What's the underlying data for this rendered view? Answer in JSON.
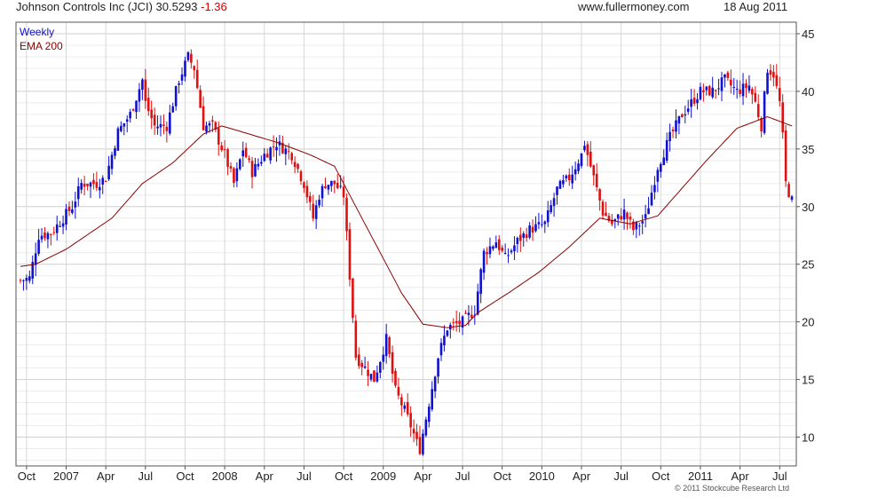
{
  "header": {
    "title": "Johnson Controls Inc (JCI) 30.5293",
    "change": "-1.36",
    "site": "www.fullermoney.com",
    "date": "18 Aug 2011"
  },
  "footer": {
    "copyright": "© 2011 Stockcube Research Ltd"
  },
  "colors": {
    "up": "#1010d0",
    "down": "#e01010",
    "ema": "#8b0000",
    "grid": "#d8d8d8"
  },
  "chart_data": {
    "type": "candlestick",
    "timeframe": "Weekly",
    "legend": [
      "Weekly",
      "EMA 200"
    ],
    "legend_position": "top-left",
    "ylim": [
      7.5,
      46
    ],
    "y_ticks": [
      10,
      15,
      20,
      25,
      30,
      35,
      40,
      45
    ],
    "x_ticks": [
      "Oct",
      "2007",
      "Apr",
      "Jul",
      "Oct",
      "2008",
      "Apr",
      "Jul",
      "Oct",
      "2009",
      "Apr",
      "Jul",
      "Oct",
      "2010",
      "Apr",
      "Jul",
      "Oct",
      "2011",
      "Apr",
      "Jul"
    ],
    "x_tick_weeks": [
      2,
      15,
      28,
      41,
      54,
      67,
      80,
      93,
      106,
      119,
      132,
      145,
      158,
      171,
      184,
      197,
      210,
      223,
      236,
      249
    ],
    "grid": true,
    "price_keypoints": [
      [
        0,
        23.6
      ],
      [
        3,
        23.8
      ],
      [
        6,
        27.5
      ],
      [
        10,
        27.7
      ],
      [
        14,
        29
      ],
      [
        17,
        30
      ],
      [
        20,
        32
      ],
      [
        25,
        32
      ],
      [
        28,
        32.5
      ],
      [
        32,
        36.5
      ],
      [
        36,
        38
      ],
      [
        40,
        41
      ],
      [
        41,
        39
      ],
      [
        44,
        37
      ],
      [
        48,
        37
      ],
      [
        52,
        41
      ],
      [
        55,
        43
      ],
      [
        57,
        42
      ],
      [
        60,
        37
      ],
      [
        63,
        37
      ],
      [
        67,
        34.5
      ],
      [
        70,
        32
      ],
      [
        73,
        35
      ],
      [
        76,
        33
      ],
      [
        80,
        34.5
      ],
      [
        84,
        35.5
      ],
      [
        89,
        34.5
      ],
      [
        93,
        32
      ],
      [
        96,
        29
      ],
      [
        98,
        31
      ],
      [
        100,
        32
      ],
      [
        103,
        32
      ],
      [
        106,
        31
      ],
      [
        108,
        24
      ],
      [
        110,
        17
      ],
      [
        113,
        16
      ],
      [
        116,
        15
      ],
      [
        120,
        18.5
      ],
      [
        123,
        14
      ],
      [
        126,
        12.3
      ],
      [
        128,
        11
      ],
      [
        130,
        9.5
      ],
      [
        131,
        9
      ],
      [
        134,
        13
      ],
      [
        137,
        17
      ],
      [
        140,
        19.5
      ],
      [
        145,
        20
      ],
      [
        149,
        21
      ],
      [
        152,
        26
      ],
      [
        156,
        27
      ],
      [
        159,
        25.5
      ],
      [
        163,
        27
      ],
      [
        167,
        28
      ],
      [
        172,
        28.5
      ],
      [
        176,
        31.5
      ],
      [
        180,
        32.5
      ],
      [
        184,
        34.5
      ],
      [
        185,
        35.5
      ],
      [
        188,
        32.5
      ],
      [
        191,
        29.5
      ],
      [
        194,
        28.5
      ],
      [
        198,
        29.5
      ],
      [
        201,
        28
      ],
      [
        205,
        29
      ],
      [
        209,
        33.5
      ],
      [
        213,
        36
      ],
      [
        217,
        38
      ],
      [
        220,
        39
      ],
      [
        223,
        40
      ],
      [
        227,
        40
      ],
      [
        231,
        41
      ],
      [
        235,
        40
      ],
      [
        239,
        40.5
      ],
      [
        241,
        39
      ],
      [
        243,
        37
      ],
      [
        245,
        42
      ],
      [
        247,
        41.5
      ],
      [
        249,
        39
      ],
      [
        250,
        36
      ],
      [
        251,
        32
      ],
      [
        253,
        30.5
      ]
    ],
    "ema_keypoints": [
      [
        0,
        24.8
      ],
      [
        5,
        25
      ],
      [
        15,
        26.3
      ],
      [
        30,
        29
      ],
      [
        40,
        32
      ],
      [
        50,
        33.8
      ],
      [
        60,
        36.3
      ],
      [
        66,
        37
      ],
      [
        75,
        36.3
      ],
      [
        85,
        35.5
      ],
      [
        95,
        34.5
      ],
      [
        103,
        33.5
      ],
      [
        110,
        30
      ],
      [
        118,
        26
      ],
      [
        125,
        22.5
      ],
      [
        132,
        19.8
      ],
      [
        140,
        19.5
      ],
      [
        146,
        19.7
      ],
      [
        150,
        20.8
      ],
      [
        160,
        22.5
      ],
      [
        170,
        24.3
      ],
      [
        180,
        26.5
      ],
      [
        190,
        29
      ],
      [
        200,
        28.5
      ],
      [
        209,
        29.2
      ],
      [
        215,
        31
      ],
      [
        225,
        34
      ],
      [
        235,
        36.8
      ],
      [
        245,
        37.8
      ],
      [
        253,
        37
      ]
    ]
  }
}
